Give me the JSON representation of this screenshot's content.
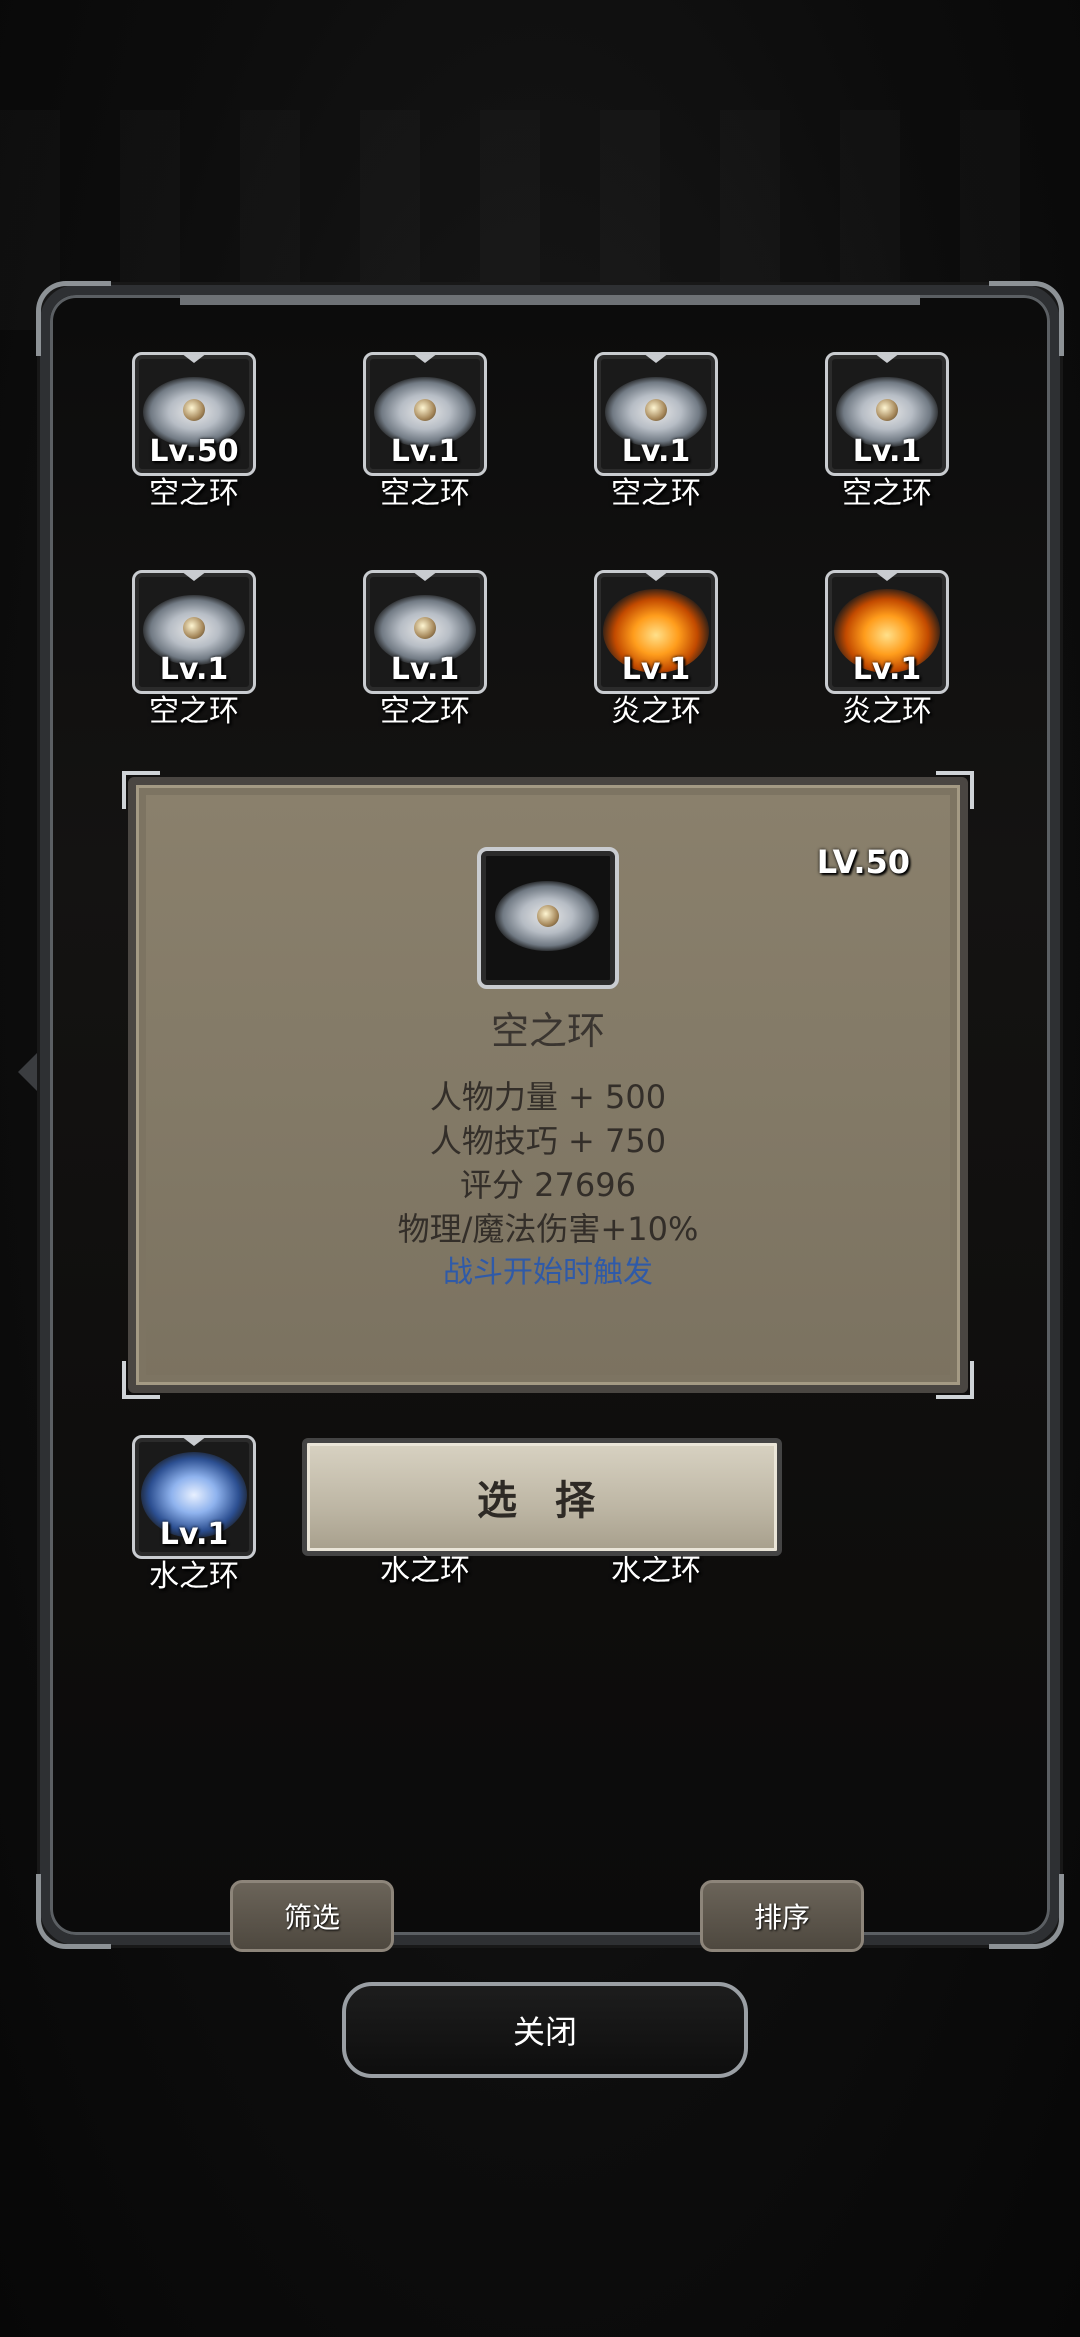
{
  "items": [
    {
      "level": "Lv.50",
      "name": "空之环",
      "type": "sky"
    },
    {
      "level": "Lv.1",
      "name": "空之环",
      "type": "sky"
    },
    {
      "level": "Lv.1",
      "name": "空之环",
      "type": "sky"
    },
    {
      "level": "Lv.1",
      "name": "空之环",
      "type": "sky"
    },
    {
      "level": "Lv.1",
      "name": "空之环",
      "type": "sky"
    },
    {
      "level": "Lv.1",
      "name": "空之环",
      "type": "sky"
    },
    {
      "level": "Lv.1",
      "name": "炎之环",
      "type": "fire"
    },
    {
      "level": "Lv.1",
      "name": "炎之环",
      "type": "fire"
    },
    {
      "level": "Lv.1",
      "name": "水之环",
      "type": "water"
    },
    {
      "level": "",
      "name": "水之环",
      "type": "water"
    },
    {
      "level": "",
      "name": "水之环",
      "type": "water"
    }
  ],
  "detail": {
    "level": "LV.50",
    "name": "空之环",
    "stats": [
      "人物力量 + 500",
      "人物技巧 + 750",
      "评分 27696",
      "物理/魔法伤害+10%"
    ],
    "trigger": "战斗开始时触发",
    "icon": "sky-ring-icon"
  },
  "buttons": {
    "select": "选 择",
    "filter": "筛选",
    "sort": "排序",
    "close": "关闭"
  },
  "colors": {
    "trigger_text": "#2f5aa8",
    "panel_bg": "#837a67"
  }
}
